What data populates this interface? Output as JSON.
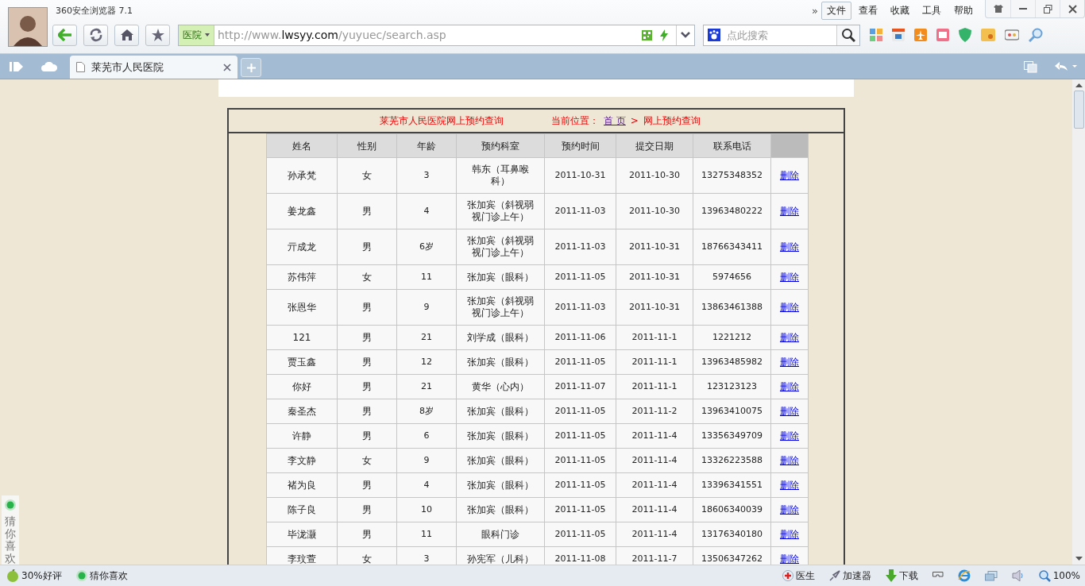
{
  "window": {
    "title": "360安全浏览器 7.1"
  },
  "overflow_chevron": "»",
  "menu": [
    {
      "label": "文件",
      "selected": true
    },
    {
      "label": "查看",
      "selected": false
    },
    {
      "label": "收藏",
      "selected": false
    },
    {
      "label": "工具",
      "selected": false
    },
    {
      "label": "帮助",
      "selected": false
    }
  ],
  "address_bar": {
    "tag": "医院",
    "url_prefix": "http://www.",
    "url_domain": "lwsyy.com",
    "url_path": "/yuyuec/search.asp"
  },
  "search": {
    "placeholder": "点此搜索"
  },
  "tabs": [
    {
      "label": "莱芜市人民医院",
      "selected": true
    }
  ],
  "page": {
    "heading": "莱芜市人民医院网上预约查询",
    "location_label": "当前位置：",
    "home_link": "首 页",
    "separator": ">",
    "current": "网上预约查询"
  },
  "table": {
    "columns": [
      "姓名",
      "性别",
      "年龄",
      "预约科室",
      "预约时间",
      "提交日期",
      "联系电话"
    ],
    "rows": [
      {
        "cells": [
          "孙承梵",
          "女",
          "3",
          "韩东（耳鼻喉科）",
          "2011-10-31",
          "2011-10-30",
          "13275348352"
        ],
        "action": "删除"
      },
      {
        "cells": [
          "姜龙鑫",
          "男",
          "4",
          "张加宾（斜视弱视门诊上午）",
          "2011-11-03",
          "2011-10-30",
          "13963480222"
        ],
        "action": "删除"
      },
      {
        "cells": [
          "亓成龙",
          "男",
          "6岁",
          "张加宾（斜视弱视门诊上午）",
          "2011-11-03",
          "2011-10-31",
          "18766343411"
        ],
        "action": "删除"
      },
      {
        "cells": [
          "苏伟萍",
          "女",
          "11",
          "张加宾（眼科）",
          "2011-11-05",
          "2011-10-31",
          "5974656"
        ],
        "action": "删除"
      },
      {
        "cells": [
          "张恩华",
          "男",
          "9",
          "张加宾（斜视弱视门诊上午）",
          "2011-11-03",
          "2011-10-31",
          "13863461388"
        ],
        "action": "删除"
      },
      {
        "cells": [
          "121",
          "男",
          "21",
          "刘学成（眼科）",
          "2011-11-06",
          "2011-11-1",
          "1221212"
        ],
        "action": "删除"
      },
      {
        "cells": [
          "贾玉鑫",
          "男",
          "12",
          "张加宾（眼科）",
          "2011-11-05",
          "2011-11-1",
          "13963485982"
        ],
        "action": "删除"
      },
      {
        "cells": [
          "你好",
          "男",
          "21",
          "黄华（心内）",
          "2011-11-07",
          "2011-11-1",
          "123123123"
        ],
        "action": "删除"
      },
      {
        "cells": [
          "秦圣杰",
          "男",
          "8岁",
          "张加宾（眼科）",
          "2011-11-05",
          "2011-11-2",
          "13963410075"
        ],
        "action": "删除"
      },
      {
        "cells": [
          "许静",
          "男",
          "6",
          "张加宾（眼科）",
          "2011-11-05",
          "2011-11-4",
          "13356349709"
        ],
        "action": "删除"
      },
      {
        "cells": [
          "李文静",
          "女",
          "9",
          "张加宾（眼科）",
          "2011-11-05",
          "2011-11-4",
          "13326223588"
        ],
        "action": "删除"
      },
      {
        "cells": [
          "褚为良",
          "男",
          "4",
          "张加宾（眼科）",
          "2011-11-05",
          "2011-11-4",
          "13396341551"
        ],
        "action": "删除"
      },
      {
        "cells": [
          "陈子良",
          "男",
          "10",
          "张加宾（眼科）",
          "2011-11-05",
          "2011-11-4",
          "18606340039"
        ],
        "action": "删除"
      },
      {
        "cells": [
          "毕泷灏",
          "男",
          "11",
          "眼科门诊",
          "2011-11-05",
          "2011-11-4",
          "13176340180"
        ],
        "action": "删除"
      },
      {
        "cells": [
          "李玟萱",
          "女",
          "3",
          "孙宪军（儿科）",
          "2011-11-08",
          "2011-11-7",
          "13506347262"
        ],
        "action": "删除"
      }
    ]
  },
  "side_widget": {
    "label": "猜你喜欢"
  },
  "status_bar": {
    "left": [
      {
        "kind": "rating",
        "label": "30%好评"
      },
      {
        "kind": "dot",
        "label": "猜你喜欢"
      }
    ],
    "right": [
      {
        "kind": "doctor",
        "label": "医生"
      },
      {
        "kind": "rocket",
        "label": "加速器"
      },
      {
        "kind": "download",
        "label": "下载"
      }
    ],
    "zoom": "100%"
  }
}
